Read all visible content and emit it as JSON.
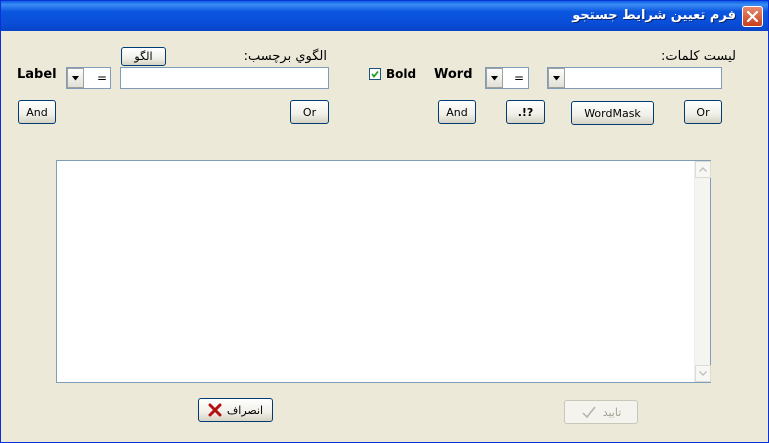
{
  "window": {
    "title": "فرم تعيين شرايط جستجو",
    "close_icon": "close-icon"
  },
  "word_section": {
    "list_label": "ليست كلمات:",
    "combo_value": "",
    "operator": "=",
    "word_label": "Word",
    "bold_label": "Bold",
    "bold_checked": true
  },
  "label_section": {
    "pattern_label": "الگوي برچسب:",
    "pattern_button": "الگو",
    "pattern_value": "",
    "operator": "=",
    "label_label": "Label"
  },
  "buttons": {
    "word_or": "Or",
    "wordmask": "WordMask",
    "special": ".!?",
    "word_and": "And",
    "label_or": "Or",
    "label_and": "And"
  },
  "footer": {
    "ok_label": "تاييد",
    "ok_enabled": false,
    "cancel_label": "انصراف"
  },
  "colors": {
    "titlebar": "#0a4fd9",
    "window_bg": "#ece9d8",
    "cancel_icon": "#b50f0f"
  }
}
